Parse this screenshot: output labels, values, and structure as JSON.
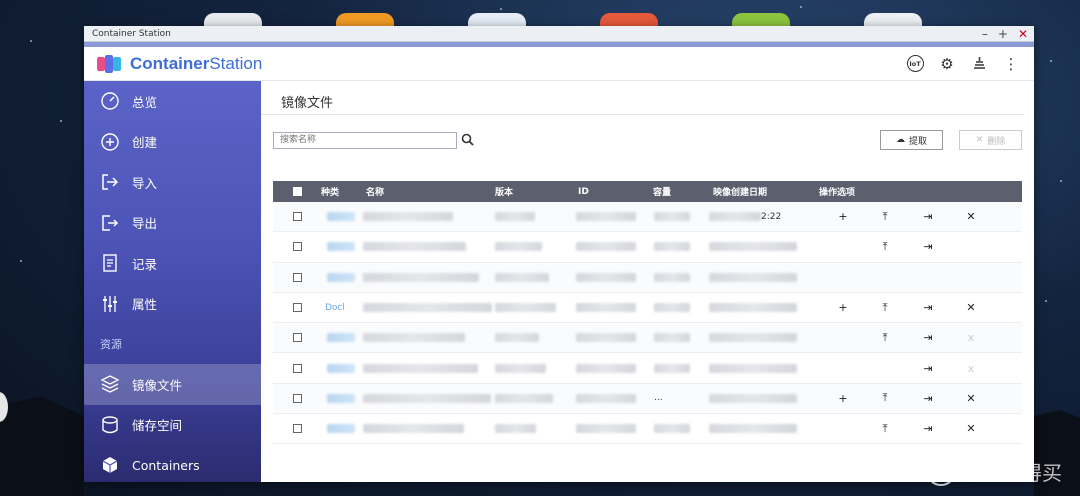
{
  "window": {
    "title": "Container Station"
  },
  "app": {
    "logo_part1": "Container",
    "logo_part2": "Station"
  },
  "header_icons": [
    "iot-icon",
    "gear-icon",
    "stack-icon",
    "more-vertical-icon"
  ],
  "header": {
    "iot_label": "IoT"
  },
  "sidebar": {
    "items": [
      {
        "label": "总览",
        "icon": "dashboard-icon"
      },
      {
        "label": "创建",
        "icon": "plus-circle-icon"
      },
      {
        "label": "导入",
        "icon": "import-icon"
      },
      {
        "label": "导出",
        "icon": "export-icon"
      },
      {
        "label": "记录",
        "icon": "log-icon"
      },
      {
        "label": "属性",
        "icon": "sliders-icon"
      }
    ],
    "section_label": "资源",
    "resource_items": [
      {
        "label": "镜像文件",
        "icon": "layers-icon",
        "active": true
      },
      {
        "label": "储存空间",
        "icon": "database-icon"
      },
      {
        "label": "Containers",
        "icon": "cube-icon"
      }
    ]
  },
  "main": {
    "page_title": "镜像文件",
    "search": {
      "placeholder": "搜索名称"
    },
    "pull_button": "提取",
    "delete_button": "删除",
    "table": {
      "columns": [
        "种类",
        "名称",
        "版本",
        "ID",
        "容量",
        "映像创建日期",
        "操作选项"
      ],
      "partial_texts": {
        "row0_date_tail": "2:22",
        "row3_type": "Docl",
        "row6_size": "..."
      }
    }
  },
  "colors": {
    "accent": "#3d6fd6",
    "sidebar": "#4d54b7",
    "table_header": "#5b5f6e"
  },
  "watermark": {
    "text": "什么值得买"
  }
}
